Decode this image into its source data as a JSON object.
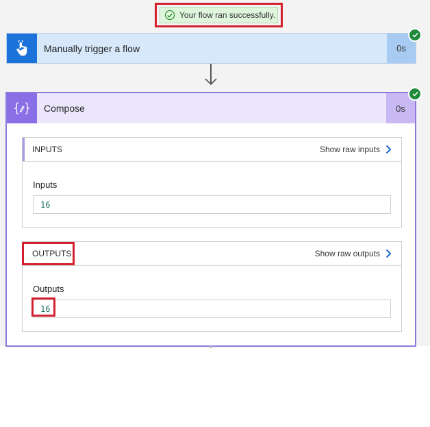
{
  "banner": {
    "message": "Your flow ran successfully."
  },
  "trigger_step": {
    "title": "Manually trigger a flow",
    "duration": "0s",
    "icon": "touch-hand-icon"
  },
  "compose_step": {
    "title": "Compose",
    "duration": "0s",
    "icon": "curly-braces-icon",
    "inputs": {
      "header": "INPUTS",
      "raw_link": "Show raw inputs",
      "field_label": "Inputs",
      "value": "16"
    },
    "outputs": {
      "header": "OUTPUTS",
      "raw_link": "Show raw outputs",
      "field_label": "Outputs",
      "value": "16"
    }
  },
  "colors": {
    "trigger_accent": "#1b73d9",
    "compose_accent": "#8a70e6",
    "success": "#1e8a3a",
    "highlight": "#d3202f"
  }
}
